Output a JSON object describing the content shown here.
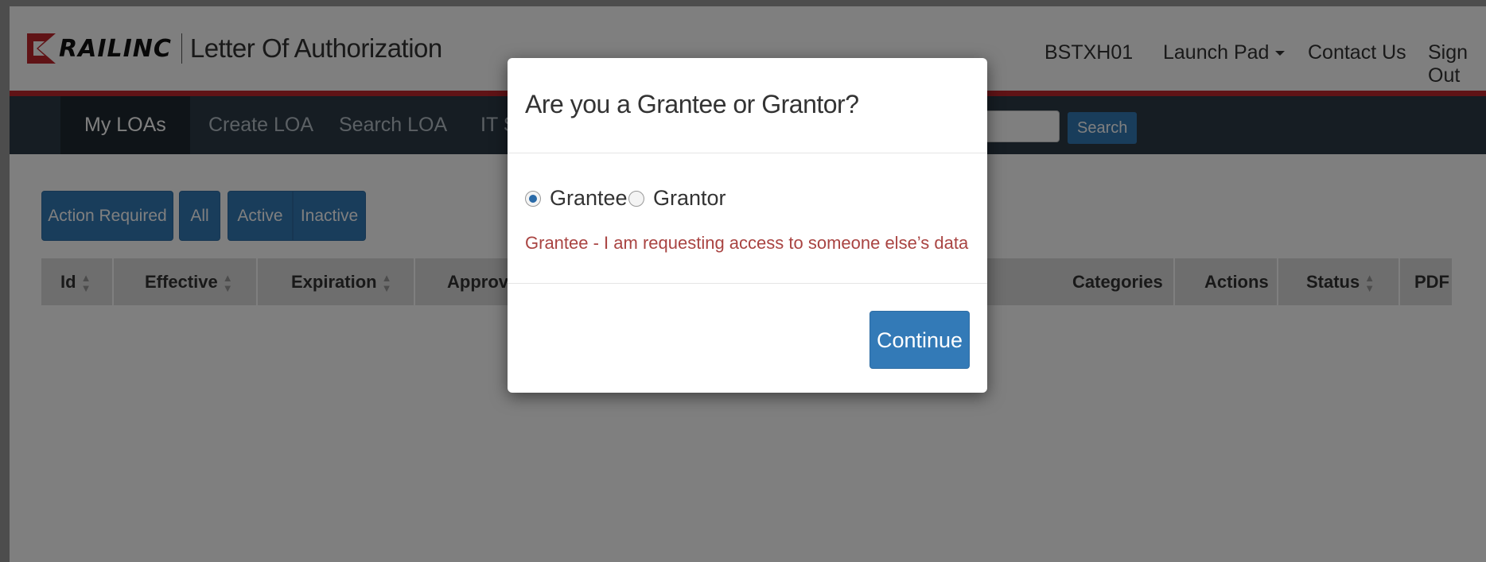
{
  "header": {
    "brand": "RAILINC",
    "app_title": "Letter Of Authorization",
    "user": "BSTXH01",
    "launch_pad": "Launch Pad",
    "contact_us": "Contact Us",
    "sign_out": "Sign Out"
  },
  "navbar": {
    "items": [
      {
        "label": "My LOAs",
        "active": true
      },
      {
        "label": "Create LOA",
        "active": false
      },
      {
        "label": "Search LOA",
        "active": false
      },
      {
        "label": "IT S",
        "active": false
      }
    ],
    "search_button": "Search"
  },
  "filters": {
    "action_required": "Action Required",
    "all": "All",
    "active": "Active",
    "inactive": "Inactive"
  },
  "table": {
    "columns": [
      "Id",
      "Effective",
      "Expiration",
      "Approval",
      "Categories",
      "Actions",
      "Status",
      "PDF"
    ]
  },
  "modal": {
    "title": "Are you a Grantee or Grantor?",
    "options": [
      {
        "label": "Grantee",
        "checked": true
      },
      {
        "label": "Grantor",
        "checked": false
      }
    ],
    "message": "Grantee - I am requesting access to someone else’s data",
    "continue_label": "Continue"
  },
  "colors": {
    "brand_red": "#c0262d",
    "navbar_bg": "#2d3b47",
    "primary_button": "#337ab7",
    "message_text": "#a94442"
  }
}
